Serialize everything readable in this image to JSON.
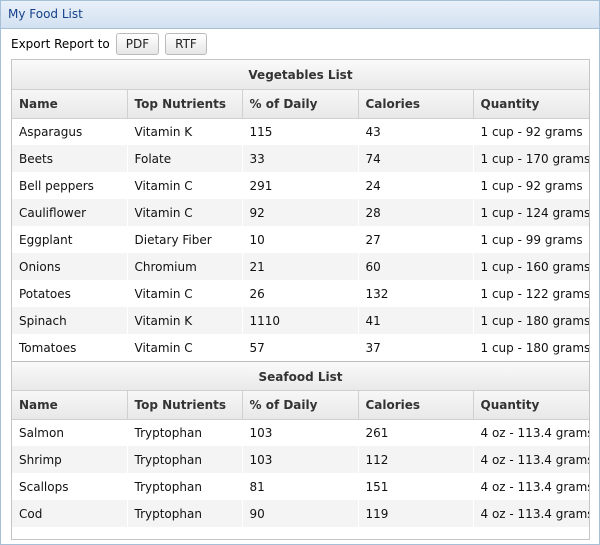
{
  "window": {
    "title": "My Food List"
  },
  "toolbar": {
    "export_label": "Export Report to",
    "pdf_label": "PDF",
    "rtf_label": "RTF"
  },
  "columns": [
    "Name",
    "Top Nutrients",
    "% of Daily",
    "Calories",
    "Quantity"
  ],
  "vegetables": {
    "title": "Vegetables List",
    "rows": [
      [
        "Asparagus",
        "Vitamin K",
        "115",
        "43",
        "1 cup - 92 grams"
      ],
      [
        "Beets",
        "Folate",
        "33",
        "74",
        "1 cup - 170 grams"
      ],
      [
        "Bell peppers",
        "Vitamin C",
        "291",
        "24",
        "1 cup - 92 grams"
      ],
      [
        "Cauliflower",
        "Vitamin C",
        "92",
        "28",
        "1 cup - 124 grams"
      ],
      [
        "Eggplant",
        "Dietary Fiber",
        "10",
        "27",
        "1 cup - 99 grams"
      ],
      [
        "Onions",
        "Chromium",
        "21",
        "60",
        "1 cup - 160 grams"
      ],
      [
        "Potatoes",
        "Vitamin C",
        "26",
        "132",
        "1 cup - 122 grams"
      ],
      [
        "Spinach",
        "Vitamin K",
        "1110",
        "41",
        "1 cup - 180 grams"
      ],
      [
        "Tomatoes",
        "Vitamin C",
        "57",
        "37",
        "1 cup - 180 grams"
      ]
    ]
  },
  "seafood": {
    "title": "Seafood List",
    "rows": [
      [
        "Salmon",
        "Tryptophan",
        "103",
        "261",
        "4 oz - 113.4 grams"
      ],
      [
        "Shrimp",
        "Tryptophan",
        "103",
        "112",
        "4 oz - 113.4 grams"
      ],
      [
        "Scallops",
        "Tryptophan",
        "81",
        "151",
        "4 oz - 113.4 grams"
      ],
      [
        "Cod",
        "Tryptophan",
        "90",
        "119",
        "4 oz - 113.4 grams"
      ]
    ]
  }
}
